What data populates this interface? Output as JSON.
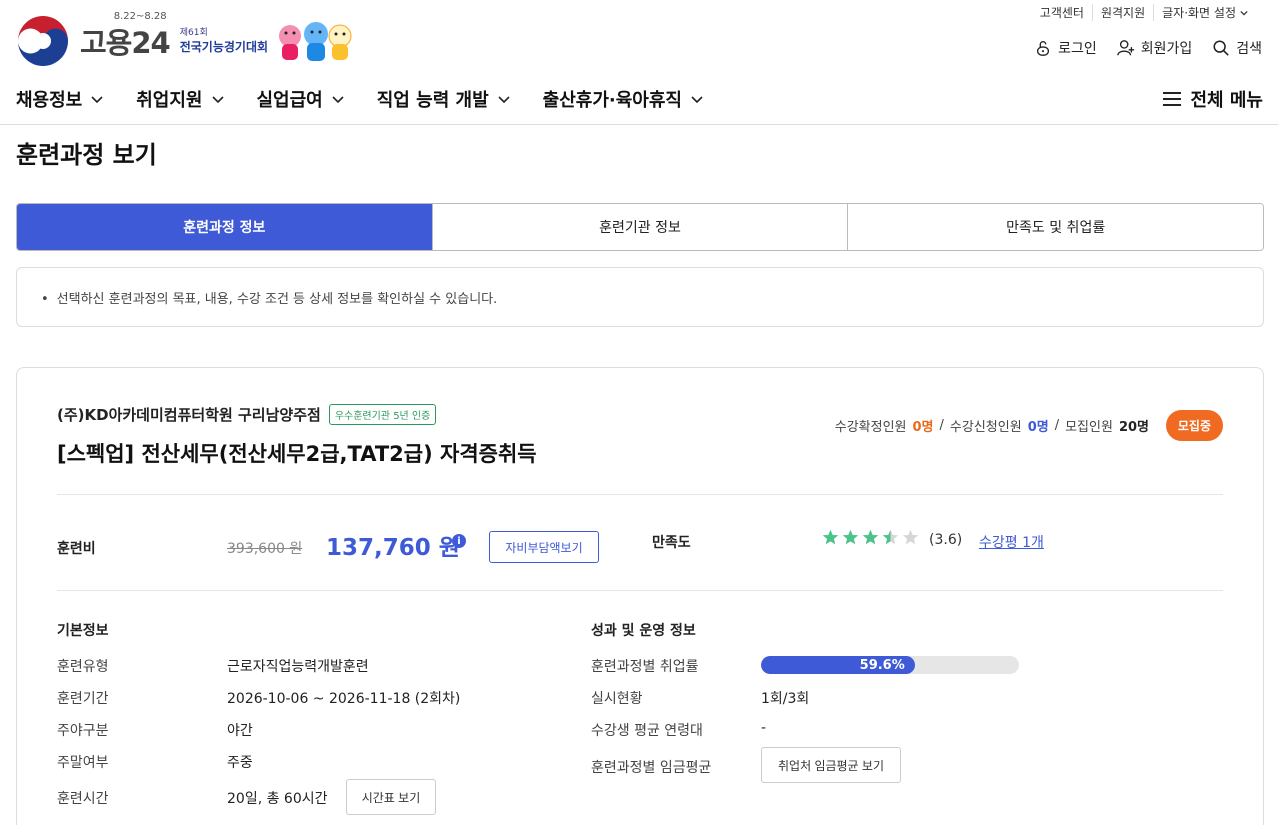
{
  "header": {
    "util_links": [
      "고객센터",
      "원격지원",
      "글자·화면 설정"
    ],
    "brand": "고용24",
    "event_dates": "8.22~8.28",
    "event_edition": "제61회",
    "event_name": "전국기능경기대회",
    "user_links": {
      "login": "로그인",
      "signup": "회원가입",
      "search": "검색"
    },
    "gnb": [
      "채용정보",
      "취업지원",
      "실업급여",
      "직업 능력 개발",
      "출산휴가·육아휴직"
    ],
    "all_menu": "전체 메뉴"
  },
  "page": {
    "title": "훈련과정 보기",
    "tabs": [
      {
        "label": "훈련과정 정보",
        "active": true
      },
      {
        "label": "훈련기관 정보",
        "active": false
      },
      {
        "label": "만족도 및 취업률",
        "active": false
      }
    ],
    "notice": "선택하신 훈련과정의 목표, 내용, 수강 조건 등 상세 정보를 확인하실 수 있습니다."
  },
  "course": {
    "institution": "(주)KD아카데미컴퓨터학원 구리남양주점",
    "badge": "우수훈련기관 5년 인증",
    "title": "[스펙업] 전산세무(전산세무2급,TAT2급) 자격증취득",
    "counts": {
      "confirmed_label": "수강확정인원",
      "confirmed": "0명",
      "applied_label": "수강신청인원",
      "applied": "0명",
      "recruit_label": "모집인원",
      "recruit": "20명"
    },
    "status": "모집중",
    "fee": {
      "label": "훈련비",
      "original": "393,600 원",
      "current": "137,760 원",
      "info_icon": "i",
      "selfpay_button": "자비부담액보기"
    },
    "satisfaction": {
      "label": "만족도",
      "rating": 3.6,
      "max": 5,
      "score_text": "(3.6)",
      "review_link": "수강평 1개"
    },
    "basic": {
      "title": "기본정보",
      "rows": [
        {
          "k": "훈련유형",
          "v": "근로자직업능력개발훈련"
        },
        {
          "k": "훈련기간",
          "v": "2026-10-06 ~ 2026-11-18 (2회차)"
        },
        {
          "k": "주야구분",
          "v": "야간"
        },
        {
          "k": "주말여부",
          "v": "주중"
        },
        {
          "k": "훈련시간",
          "v": "20일, 총 60시간"
        }
      ],
      "timetable_button": "시간표 보기"
    },
    "performance": {
      "title": "성과 및 운영 정보",
      "employment_label": "훈련과정별 취업률",
      "employment_rate": 59.6,
      "employment_text": "59.6%",
      "rows": [
        {
          "k": "실시현황",
          "v": "1회/3회"
        },
        {
          "k": "수강생 평균 연령대",
          "v": "-"
        }
      ],
      "wage_label": "훈련과정별 임금평균",
      "wage_button": "취업처 임금평균 보기"
    }
  },
  "colors": {
    "primary": "#3f5ad6",
    "orange": "#f06a22",
    "star": "#4bc48b",
    "badge_green": "#2a9a5b"
  }
}
